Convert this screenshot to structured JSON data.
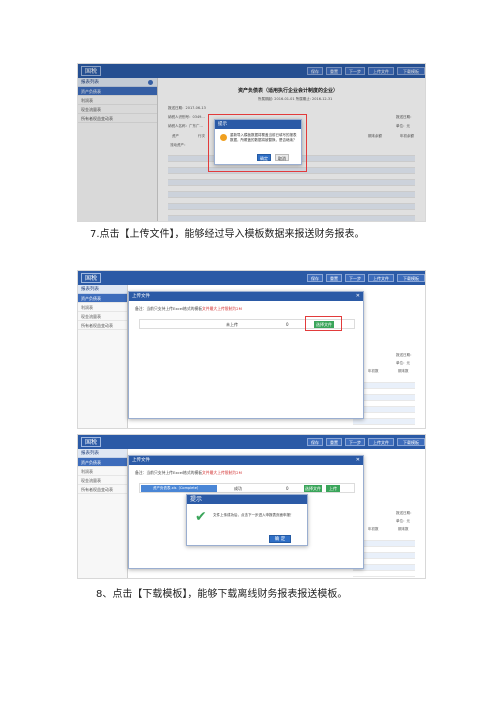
{
  "app": {
    "logo": "国税",
    "toolbar": [
      "保存",
      "重置",
      "下一步",
      "上传文件",
      "下载模板"
    ],
    "sidebar_title": "报表列表",
    "sidebar_items": [
      "资产负债表",
      "利润表",
      "现金流量表",
      "所有者权益变动表"
    ]
  },
  "shot1": {
    "report_title": "资产负债表（适用执行企业会计制度的企业）",
    "date_line": "所属期起: 2016-01-01  所属期止: 2016-12-31",
    "left_info": [
      "报送日期：2017-06-13",
      "纳税人识别号：0349...",
      "纳税人名称：广东广..."
    ],
    "table_header": [
      "资产",
      "行次",
      "期末余额",
      "年初余额"
    ],
    "right_info": [
      "报送日期：",
      "单位：元"
    ],
    "row_label": "流动资产：",
    "alert_title": "提示",
    "alert_message": "重新导入模板数据将覆盖当前已填写的报表数据，所覆盖的数据将被替换，是否继续？",
    "confirm_label": "确定",
    "cancel_label": "取消"
  },
  "caption1": "7.点击【上传文件】，能够经过导入模板数据来报送财务报表。",
  "shot2": {
    "dialog_title": "上传文件",
    "note_prefix": "备注：当前只支持上传Excel格式的模板",
    "note_red": "文件最大上传限制为2M",
    "file_status": "未上传",
    "file_size": "0",
    "choose_button": "选择文件",
    "right_info": [
      "报送日期：",
      "单位：元"
    ],
    "col_labels": [
      "年初数",
      "期末数"
    ]
  },
  "shot3": {
    "dialog_title": "上传文件",
    "note_prefix": "备注：当前只支持上传Excel格式的模板",
    "note_red": "文件最大上传限制为2M",
    "progress_label": "资产负债表.xls（Complete）",
    "status": "成功",
    "file_size": "0",
    "choose_button": "选择文件",
    "upload_button": "上传",
    "alert_title": "提示",
    "alert_message": "文件上传成功后，点击下一步进入申报表页面申报！",
    "confirm_label": "确 定",
    "right_info": [
      "报送日期：",
      "单位：元"
    ],
    "col_labels": [
      "年初数",
      "期末数"
    ]
  },
  "caption2": "8、点击【下载模板】，能够下载离线财务报表报送模板。"
}
